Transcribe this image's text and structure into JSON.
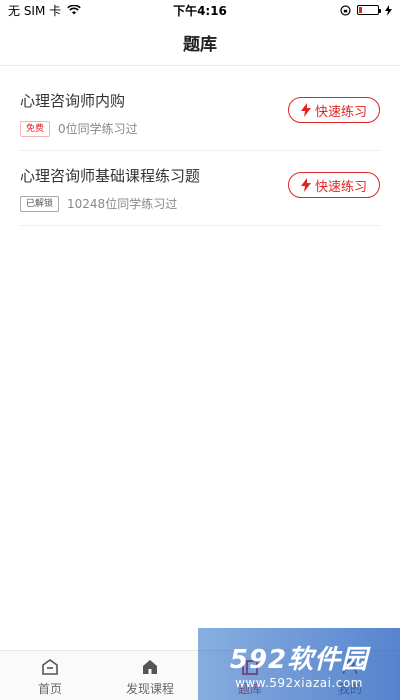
{
  "status_bar": {
    "carrier": "无 SIM 卡",
    "time": "下午4:16",
    "battery_level": 0.15
  },
  "nav": {
    "title": "题库"
  },
  "items": [
    {
      "title": "心理咨询师内购",
      "badge": "免费",
      "meta": "0位同学练习过",
      "action": "快速练习"
    },
    {
      "title": "心理咨询师基础课程练习题",
      "badge": "已解锁",
      "meta": "10248位同学练习过",
      "action": "快速练习"
    }
  ],
  "tabs": [
    {
      "label": "首页",
      "icon": "home-icon"
    },
    {
      "label": "发现课程",
      "icon": "discover-icon"
    },
    {
      "label": "题库",
      "icon": "question-bank-icon",
      "active": true
    },
    {
      "label": "我的",
      "icon": "profile-icon"
    }
  ],
  "watermark": {
    "logo": "592软件园",
    "url": "www.592xiazai.com"
  },
  "colors": {
    "accent": "#e02424"
  }
}
